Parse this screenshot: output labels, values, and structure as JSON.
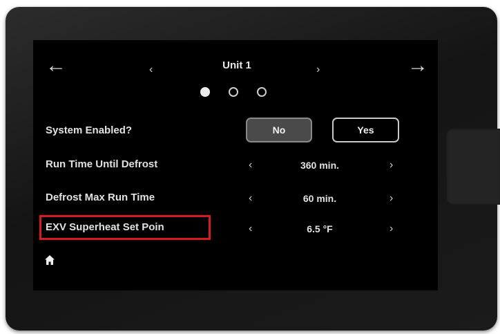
{
  "header": {
    "title": "Unit 1",
    "back_arrow": "←",
    "forward_arrow": "→",
    "prev_chevron": "‹",
    "next_chevron": "›"
  },
  "pager": {
    "total": 3,
    "active": 1
  },
  "settings": {
    "system_enabled": {
      "label": "System Enabled?",
      "options": [
        "No",
        "Yes"
      ],
      "selected": "No"
    },
    "rows": [
      {
        "label": "Run Time Until Defrost",
        "value": "360 min."
      },
      {
        "label": "Defrost Max Run Time",
        "value": "60 min."
      },
      {
        "label": "EXV Superheat Set Poin",
        "value": "6.5 °F"
      }
    ],
    "decrement": "‹",
    "increment": "›"
  },
  "highlight_color": "#d71920",
  "icons": {
    "back": "arrow-left-icon",
    "forward": "arrow-right-icon",
    "home": "home-icon"
  }
}
